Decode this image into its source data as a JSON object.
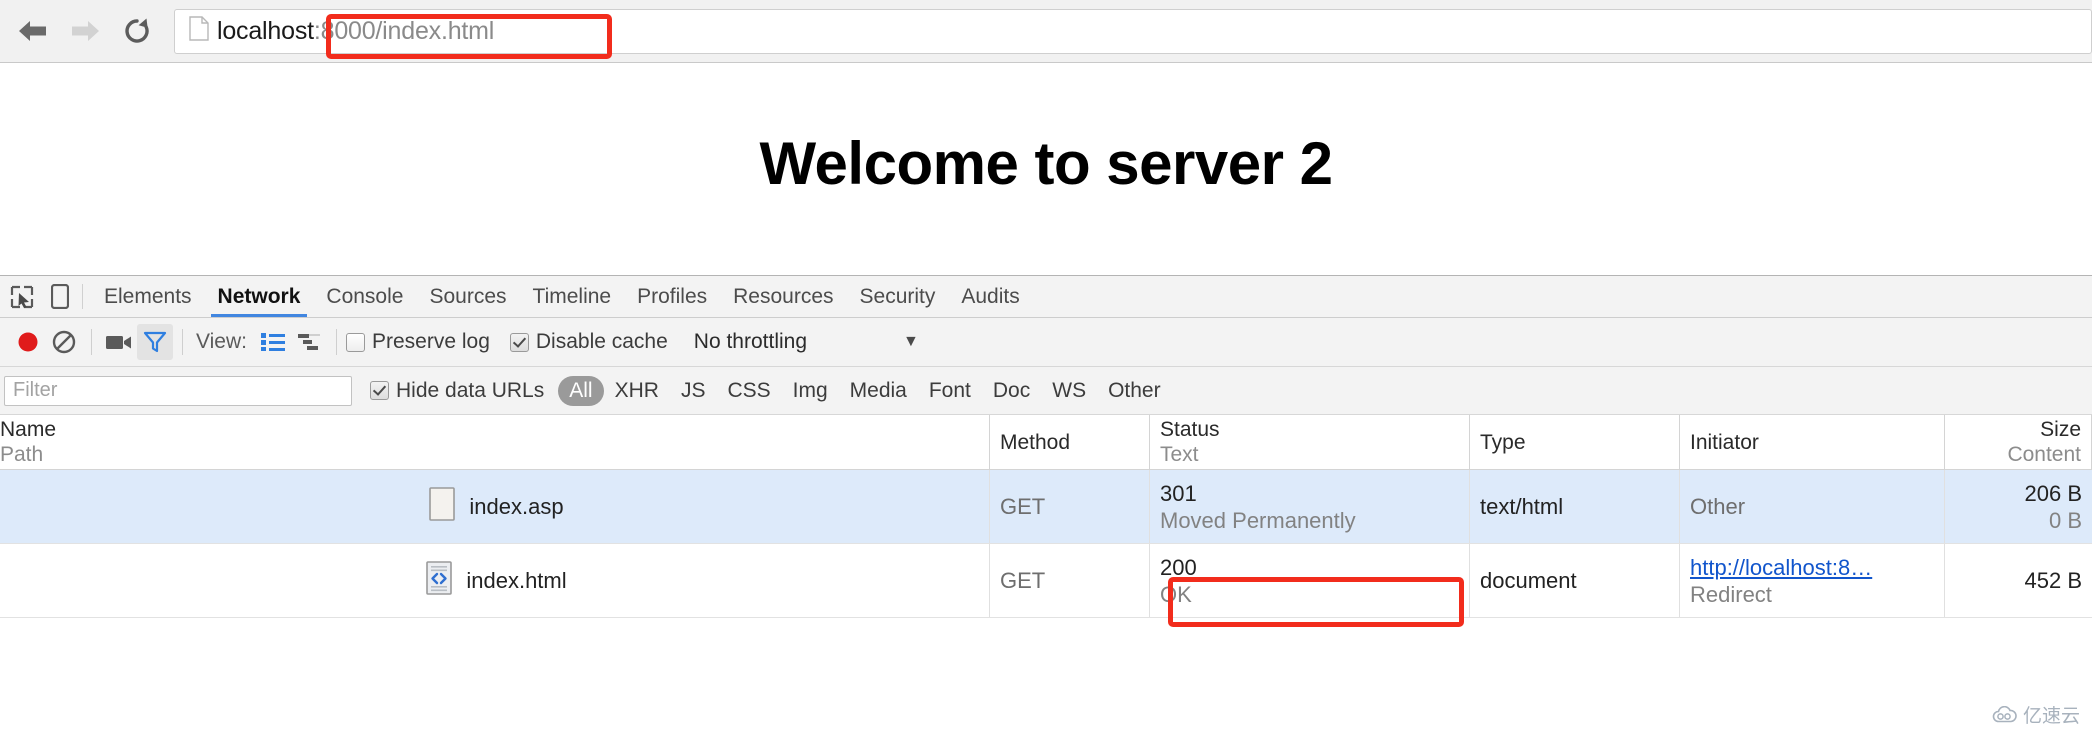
{
  "browser": {
    "back_label": "Back",
    "forward_label": "Forward",
    "reload_label": "Reload",
    "url_host": "localhost",
    "url_rest": ":8000/index.html",
    "url_full": "localhost:8000/index.html",
    "annotation_color": "#f22c1c"
  },
  "page": {
    "heading": "Welcome to server 2"
  },
  "devtools": {
    "tabs": [
      {
        "label": "Elements",
        "active": false
      },
      {
        "label": "Network",
        "active": true
      },
      {
        "label": "Console",
        "active": false
      },
      {
        "label": "Sources",
        "active": false
      },
      {
        "label": "Timeline",
        "active": false
      },
      {
        "label": "Profiles",
        "active": false
      },
      {
        "label": "Resources",
        "active": false
      },
      {
        "label": "Security",
        "active": false
      },
      {
        "label": "Audits",
        "active": false
      }
    ],
    "controls": {
      "view_label": "View:",
      "preserve_log_label": "Preserve log",
      "preserve_log_checked": false,
      "disable_cache_label": "Disable cache",
      "disable_cache_checked": true,
      "throttling": "No throttling",
      "throttle_arrow": "▼"
    },
    "filter_row": {
      "filter_placeholder": "Filter",
      "filter_value": "",
      "hide_data_urls_label": "Hide data URLs",
      "hide_data_urls_checked": true,
      "types": [
        {
          "label": "All",
          "active": true
        },
        {
          "label": "XHR",
          "active": false
        },
        {
          "label": "JS",
          "active": false
        },
        {
          "label": "CSS",
          "active": false
        },
        {
          "label": "Img",
          "active": false
        },
        {
          "label": "Media",
          "active": false
        },
        {
          "label": "Font",
          "active": false
        },
        {
          "label": "Doc",
          "active": false
        },
        {
          "label": "WS",
          "active": false
        },
        {
          "label": "Other",
          "active": false
        }
      ]
    },
    "table": {
      "headers": [
        {
          "main": "Name",
          "sub": "Path"
        },
        {
          "main": "Method",
          "sub": ""
        },
        {
          "main": "Status",
          "sub": "Text"
        },
        {
          "main": "Type",
          "sub": ""
        },
        {
          "main": "Initiator",
          "sub": ""
        },
        {
          "main": "Size",
          "sub": "Content"
        }
      ],
      "rows": [
        {
          "name": "index.asp",
          "icon": "blank-page-icon",
          "method": "GET",
          "status_code": "301",
          "status_text": "Moved Permanently",
          "type": "text/html",
          "initiator_main": "Other",
          "initiator_sub": "",
          "initiator_is_link": false,
          "size": "206 B",
          "content_size": "0 B",
          "selected": true
        },
        {
          "name": "index.html",
          "icon": "document-code-icon",
          "method": "GET",
          "status_code": "200",
          "status_text": "OK",
          "type": "document",
          "initiator_main": "http://localhost:8…",
          "initiator_sub": "Redirect",
          "initiator_is_link": true,
          "size": "452 B",
          "content_size": "",
          "selected": false
        }
      ]
    }
  },
  "watermark": {
    "text": "亿速云"
  }
}
